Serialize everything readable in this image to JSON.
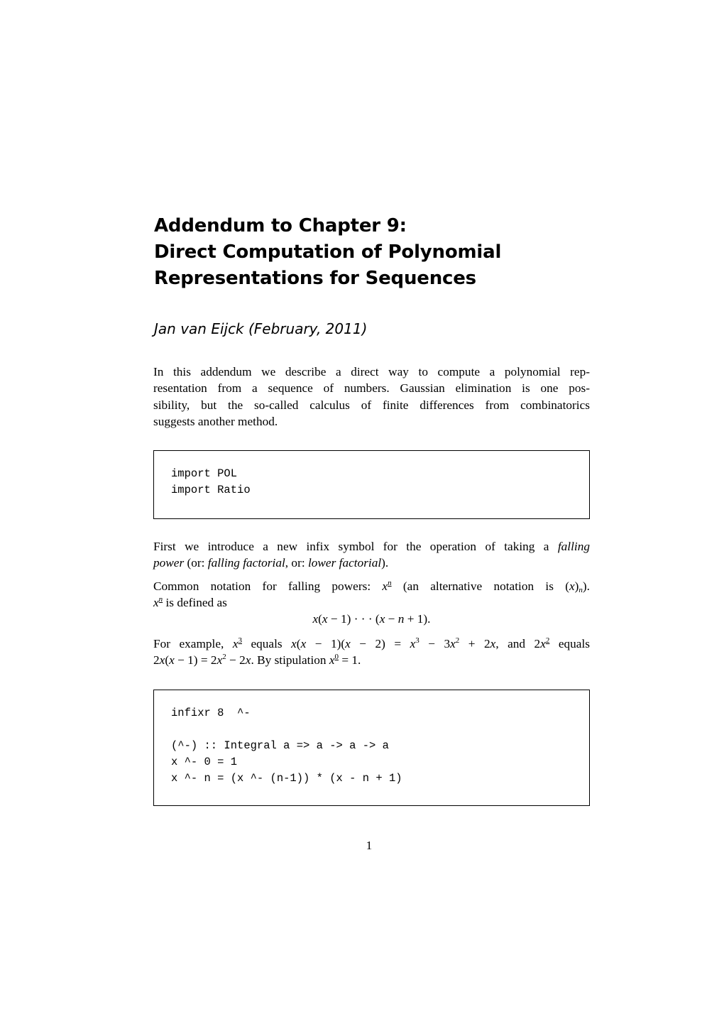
{
  "title_lines": [
    "Addendum to Chapter 9:",
    "Direct Computation of Polynomial",
    "Representations for Sequences"
  ],
  "author": "Jan van Eijck (February, 2011)",
  "intro": {
    "lines": [
      "In this addendum we describe a direct way to compute a polynomial rep-",
      "resentation from a sequence of numbers. Gaussian elimination is one pos-",
      "sibility, but the so-called calculus of finite differences from combinatorics",
      "suggests another method."
    ]
  },
  "code_block_1": {
    "lines": [
      "import POL",
      "import Ratio"
    ]
  },
  "falling_power": {
    "line1_text": "First we introduce a new infix symbol for the operation of taking a ",
    "line1_em": "falling",
    "line2_em1": "power",
    "line2_t1": " (or: ",
    "line2_em2": "falling factorial",
    "line2_t2": ", or: ",
    "line2_em3": "lower factorial",
    "line2_t3": ")."
  },
  "notation": {
    "line1_pre": "Common notation for falling powers: ",
    "x": "x",
    "n": "n",
    "line1_mid": " (an alternative notation is (",
    "line1_post": ").",
    "line2_post": " is defined as"
  },
  "definition_equation": {
    "x1": "x",
    "t1": "(",
    "x2": "x",
    "t2": " − 1) · · · (",
    "x3": "x",
    "t3": " − ",
    "n": "n",
    "t4": " + 1)."
  },
  "example": {
    "l1_a": "For example, ",
    "exp3": "3",
    "l1_b": " equals ",
    "l1_c": "(",
    "l1_d": " − 1)(",
    "l1_e": " − 2) = ",
    "l1_f": " − 3",
    "l1_g": " + 2",
    "l1_h": ", and 2",
    "exp2": "2",
    "l1_i": " equals",
    "l2_a": "2",
    "l2_b": "(",
    "l2_c": " − 1) = 2",
    "l2_d": " − 2",
    "l2_e": ". By stipulation ",
    "exp0": "0",
    "l2_f": " = 1.",
    "sup3": "3",
    "sup2": "2"
  },
  "code_block_2": {
    "lines": [
      "infixr 8  ^-",
      "",
      "(^-) :: Integral a => a -> a -> a",
      "x ^- 0 = 1",
      "x ^- n = (x ^- (n-1)) * (x - n + 1)"
    ]
  },
  "page_number": "1"
}
